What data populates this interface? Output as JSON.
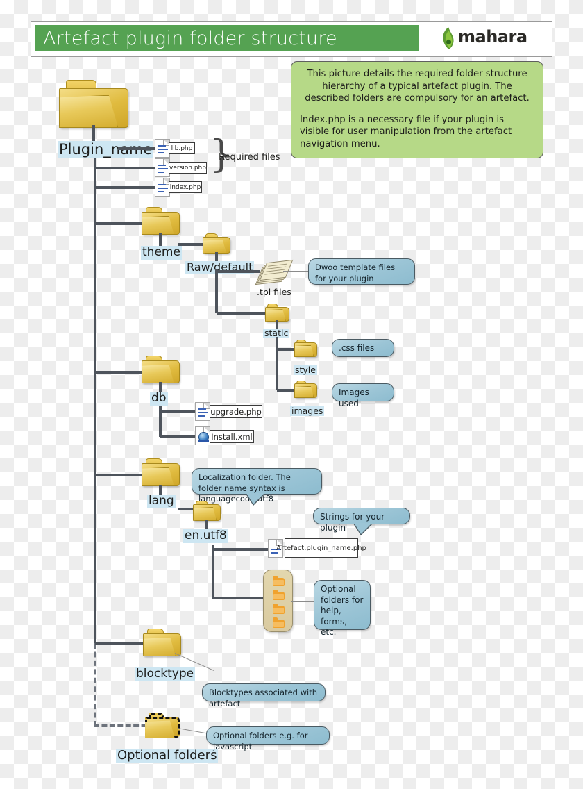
{
  "header": {
    "title": "Artefact plugin  folder structure",
    "logo_text": "mahara",
    "logo_icon": "mahara-koru-icon",
    "green_hex": "#55a252"
  },
  "description": {
    "paragraph1": "This picture details the required folder structure hierarchy of a typical artefact plugin. The described folders are compulsory for an artefact.",
    "paragraph2": "Index.php is a necessary file if your plugin is visible for user manipulation from the artefact navigation menu.",
    "fill_hex": "#b6d987"
  },
  "tree": {
    "root": {
      "label": "Plugin_name",
      "icon": "folder-icon"
    },
    "required_files_brace_label": "Required files",
    "files": [
      {
        "name": "lib.php",
        "icon": "file-icon"
      },
      {
        "name": "version.php",
        "icon": "file-icon"
      },
      {
        "name": "index.php",
        "icon": "file-icon"
      }
    ],
    "theme": {
      "label": "theme",
      "child": {
        "label": "Raw/default",
        "tpl": {
          "label": ".tpl files",
          "icon": "document-stack-icon",
          "callout": "Dwoo template files for your plugin"
        },
        "static": {
          "label": "static",
          "children": [
            {
              "label": "style",
              "callout": ".css files"
            },
            {
              "label": "images",
              "callout": "Images used"
            }
          ]
        }
      }
    },
    "db": {
      "label": "db",
      "files": [
        {
          "name": "upgrade.php",
          "icon": "file-icon"
        },
        {
          "name": "Install.xml",
          "icon": "xml-file-icon"
        }
      ]
    },
    "lang": {
      "label": "lang",
      "callout": "Localization folder. The folder name syntax is languagecode.utf8",
      "child": {
        "label": "en.utf8",
        "file": {
          "name": "Artefact.plugin_name.php",
          "icon": "file-icon"
        },
        "file_callout": "Strings for your plugin",
        "optional_panel": {
          "callout": "Optional folders for help, forms, etc.",
          "folder_count": 4,
          "icon": "mini-folder-icon"
        }
      }
    },
    "blocktype": {
      "label": "blocktype",
      "callout": "Blocktypes associated with artefact"
    },
    "optional_folders": {
      "label": "Optional folders",
      "callout": "Optional folders e.g. for javascript",
      "icon": "dashed-folder-icon"
    }
  },
  "colors": {
    "connector": "#4e545c",
    "callout": "#9cc5d6",
    "label_highlight": "#cde6f2",
    "folder": "#e8c95a"
  }
}
